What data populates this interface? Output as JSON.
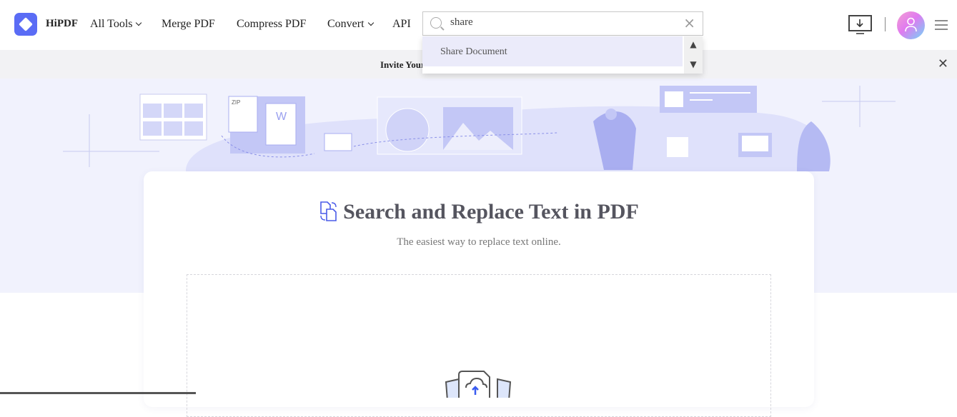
{
  "nav": {
    "brand": "HiPDF",
    "items": [
      {
        "label": "All Tools",
        "dropdown": true
      },
      {
        "label": "Merge PDF"
      },
      {
        "label": "Compress PDF"
      },
      {
        "label": "Convert",
        "dropdown": true
      },
      {
        "label": "API"
      }
    ]
  },
  "search": {
    "value": "share",
    "suggestions": [
      "Share Document"
    ]
  },
  "promo": {
    "text": "Invite Your"
  },
  "main": {
    "title": "Search and Replace Text in PDF",
    "subtitle": "The easiest way to replace text online."
  },
  "colors": {
    "accent": "#5a6cf5",
    "hero_bg": "#f1f2fd"
  },
  "icons": [
    "logo-icon",
    "search-icon",
    "clear-icon",
    "download-app-icon",
    "avatar",
    "menu-icon",
    "close-icon",
    "replace-text-icon",
    "upload-cloud-icon"
  ]
}
